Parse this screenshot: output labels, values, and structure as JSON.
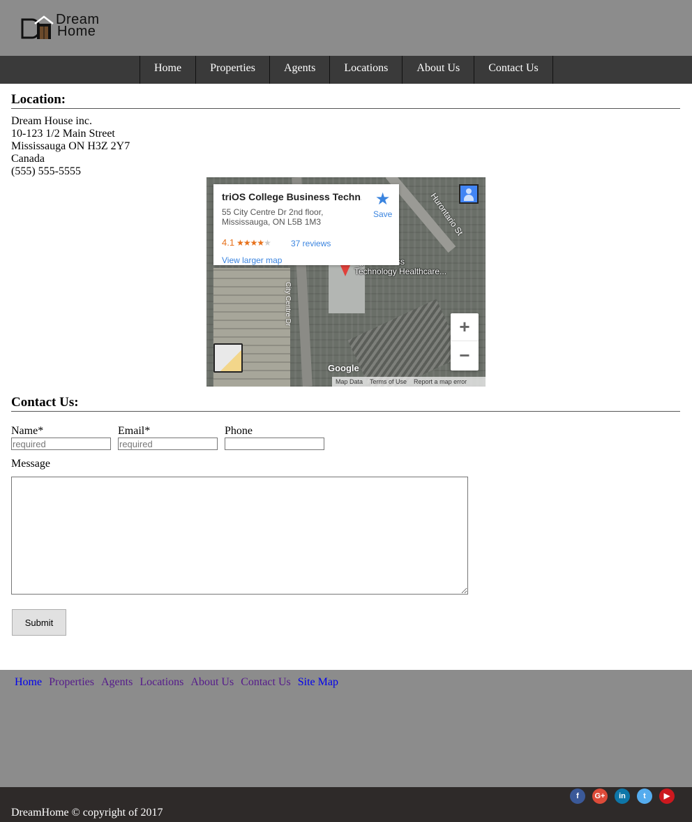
{
  "header": {
    "logo_line1": "Dream",
    "logo_line2": "Home"
  },
  "nav": {
    "items": [
      "Home",
      "Properties",
      "Agents",
      "Locations",
      "About Us",
      "Contact Us"
    ]
  },
  "location": {
    "title": "Location:",
    "address": [
      "Dream House inc.",
      "10-123 1/2 Main Street",
      "Mississauga ON H3Z 2Y7",
      "Canada",
      "(555) 555-5555"
    ]
  },
  "map": {
    "place_name": "triOS College Business Techn...",
    "address_line1": "55 City Centre Dr 2nd floor,",
    "address_line2": "Mississauga, ON L5B 1M3",
    "rating": "4.1",
    "reviews": "37 reviews",
    "view_larger": "View larger map",
    "save": "Save",
    "street_label1": "City Centre Dr",
    "street_label2": "Hurontario St",
    "place_label1": "ege Business",
    "place_label2": "Technology Healthcare...",
    "zoom_in": "+",
    "zoom_out": "−",
    "brand": "Google",
    "attribution": [
      "Map Data",
      "Terms of Use",
      "Report a map error"
    ]
  },
  "contact": {
    "title": "Contact Us:",
    "name_label": "Name*",
    "email_label": "Email*",
    "phone_label": "Phone",
    "message_label": "Message",
    "name_placeholder": "required",
    "email_placeholder": "required",
    "submit": "Submit"
  },
  "footer": {
    "links": [
      "Home",
      "Properties",
      "Agents",
      "Locations",
      "About Us",
      "Contact Us",
      "Site Map"
    ],
    "copyright": "DreamHome © copyright of 2017",
    "socials": [
      {
        "name": "facebook-icon",
        "glyph": "f",
        "color": "#3b5998"
      },
      {
        "name": "google-plus-icon",
        "glyph": "G+",
        "color": "#dd4b39"
      },
      {
        "name": "linkedin-icon",
        "glyph": "in",
        "color": "#0e76a8"
      },
      {
        "name": "twitter-icon",
        "glyph": "t",
        "color": "#55acee"
      },
      {
        "name": "youtube-icon",
        "glyph": "▶",
        "color": "#cc181e"
      }
    ]
  },
  "colors": {
    "header_bg": "#8c8c8c",
    "nav_bg": "#3a3a3a",
    "footer_bottom_bg": "#2e2a29",
    "visited_link": "#551a8b",
    "link": "#0000ee"
  }
}
